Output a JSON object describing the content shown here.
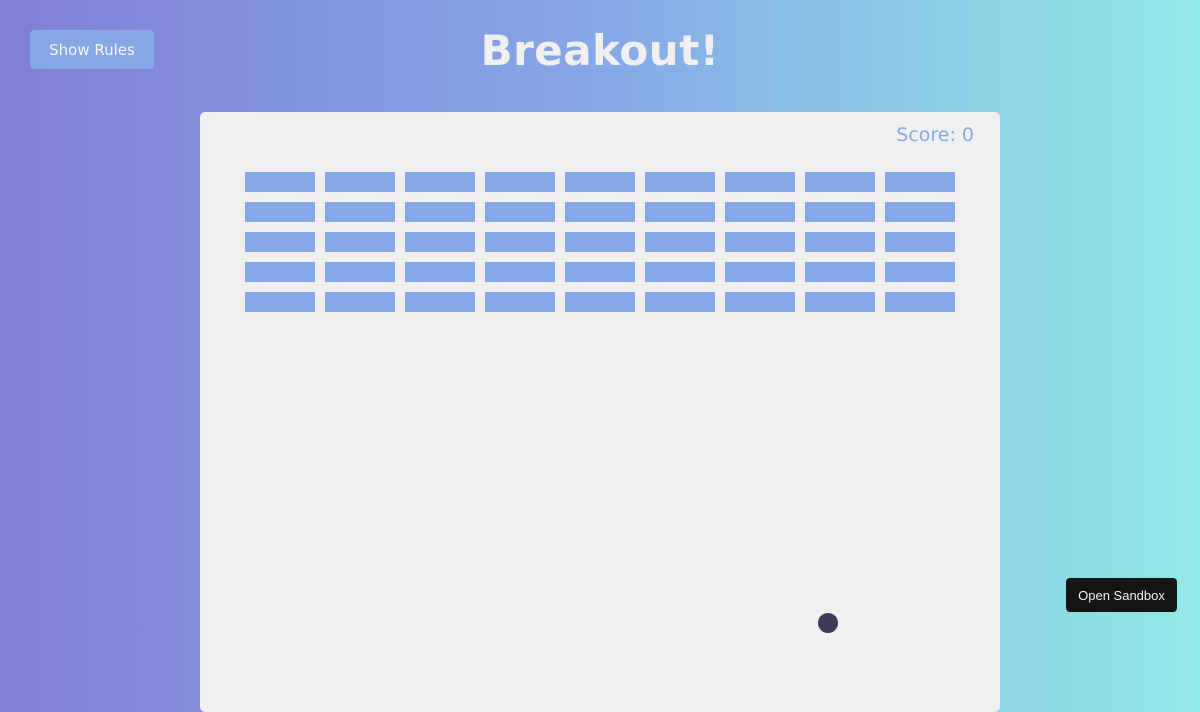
{
  "header": {
    "title": "Breakout!",
    "show_rules_label": "Show Rules"
  },
  "game": {
    "score_label": "Score:",
    "score": 0,
    "score_text": "Score: 0",
    "bricks": {
      "rows": 5,
      "columns": 9,
      "color": "#86a8e7"
    },
    "ball_color": "#3a3a5a"
  },
  "footer": {
    "open_sandbox_label": "Open Sandbox"
  }
}
